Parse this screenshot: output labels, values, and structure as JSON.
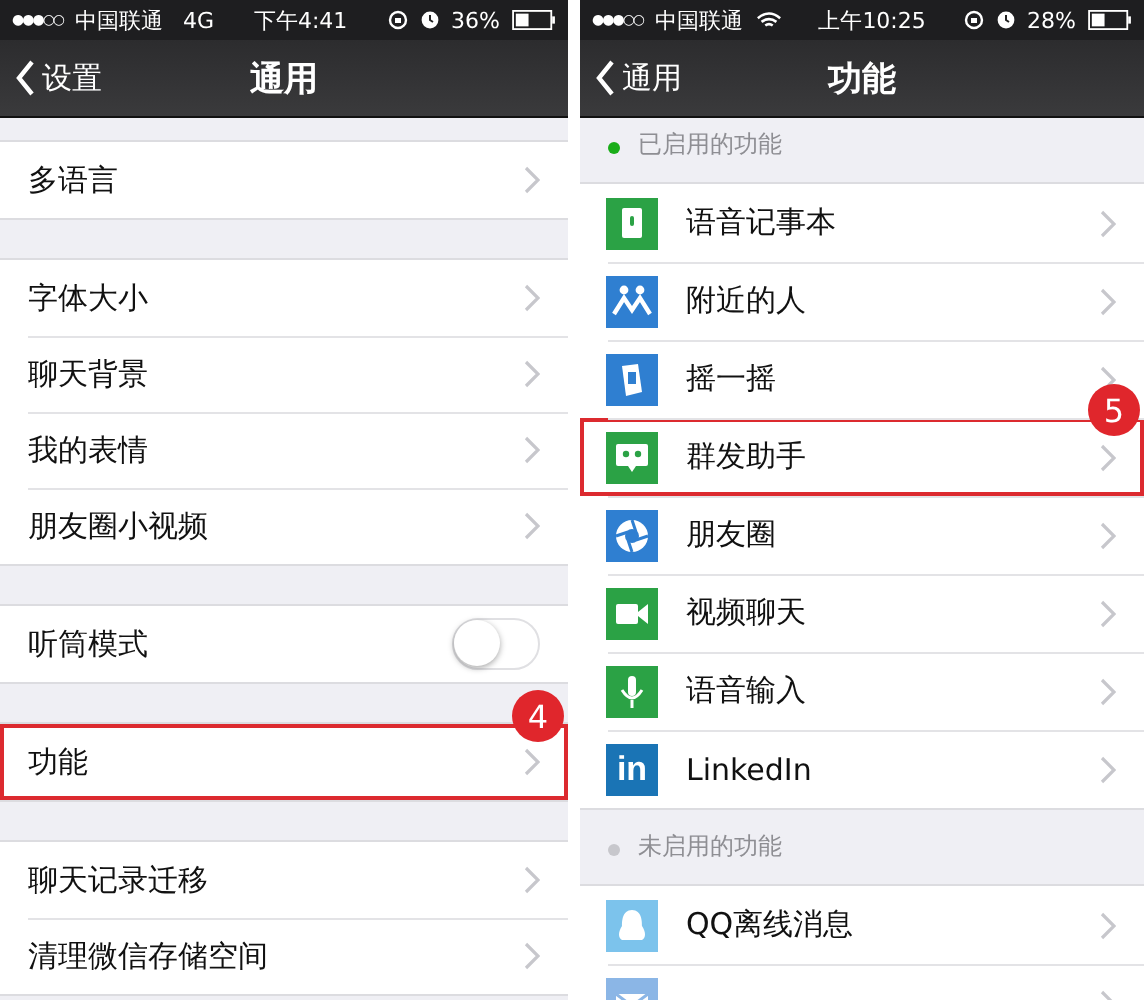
{
  "screens": [
    {
      "status_bar": {
        "signal": "●●●○○",
        "carrier": "中国联通",
        "network": {
          "kind": "cellular",
          "label": "4G"
        },
        "time": "下午4:41",
        "battery": "36%"
      },
      "nav": {
        "back": "设置",
        "title": "通用"
      },
      "groups": [
        {
          "rows": [
            {
              "kind": "link",
              "label": "多语言",
              "highlighted": false
            }
          ]
        },
        {
          "rows": [
            {
              "kind": "link",
              "label": "字体大小",
              "highlighted": false
            },
            {
              "kind": "link",
              "label": "聊天背景",
              "highlighted": false
            },
            {
              "kind": "link",
              "label": "我的表情",
              "highlighted": false
            },
            {
              "kind": "link",
              "label": "朋友圈小视频",
              "highlighted": false
            }
          ]
        },
        {
          "rows": [
            {
              "kind": "toggle",
              "label": "听筒模式",
              "on": false
            }
          ]
        },
        {
          "rows": [
            {
              "kind": "link",
              "label": "功能",
              "highlighted": true,
              "callout": "4"
            }
          ]
        },
        {
          "rows": [
            {
              "kind": "link",
              "label": "聊天记录迁移",
              "highlighted": false
            },
            {
              "kind": "link",
              "label": "清理微信存储空间",
              "highlighted": false
            }
          ]
        }
      ]
    },
    {
      "status_bar": {
        "signal": "●●●○○",
        "carrier": "中国联通",
        "network": {
          "kind": "wifi"
        },
        "time": "上午10:25",
        "battery": "28%"
      },
      "nav": {
        "back": "通用",
        "title": "功能"
      },
      "groups": [
        {
          "header": "已启用的功能",
          "color": "#1aad19",
          "rows": [
            {
              "kind": "link",
              "label": "语音记事本",
              "color": "#2ba245",
              "highlighted": false
            },
            {
              "kind": "link",
              "label": "附近的人",
              "color": "#2f7fd1",
              "highlighted": false
            },
            {
              "kind": "link",
              "label": "摇一摇",
              "color": "#2f7fd1",
              "highlighted": false
            },
            {
              "kind": "link",
              "label": "群发助手",
              "color": "#2ba245",
              "highlighted": true,
              "callout": "5"
            },
            {
              "kind": "link",
              "label": "朋友圈",
              "color": "#2f7fd1",
              "highlighted": false
            },
            {
              "kind": "link",
              "label": "视频聊天",
              "color": "#2ba245",
              "highlighted": false
            },
            {
              "kind": "link",
              "label": "语音输入",
              "color": "#2ba245",
              "highlighted": false
            },
            {
              "kind": "link",
              "label": "LinkedIn",
              "color": "#1a74b5",
              "icon_text": "in",
              "highlighted": false
            }
          ]
        },
        {
          "header": "未启用的功能",
          "color": "#c7c7cc",
          "rows": [
            {
              "kind": "link",
              "label": "QQ离线消息",
              "color": "#7cc3ec",
              "highlighted": false
            },
            {
              "kind": "link",
              "color": "#8bb6e6",
              "highlighted": false
            }
          ]
        }
      ]
    }
  ]
}
